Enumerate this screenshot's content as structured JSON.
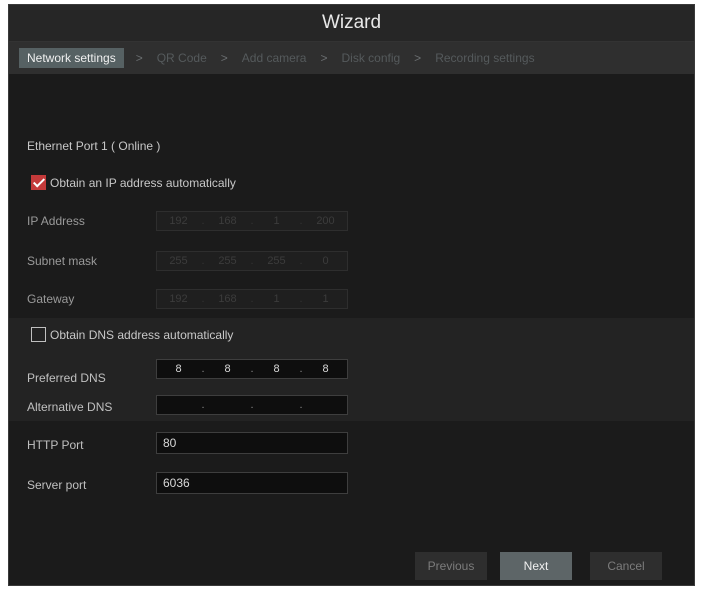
{
  "window": {
    "title": "Wizard"
  },
  "steps": [
    {
      "label": "Network settings",
      "active": true
    },
    {
      "label": "QR Code",
      "active": false
    },
    {
      "label": "Add camera",
      "active": false
    },
    {
      "label": "Disk config",
      "active": false
    },
    {
      "label": "Recording settings",
      "active": false
    }
  ],
  "separator": ">",
  "ethernet": {
    "title": "Ethernet Port 1 ( Online )"
  },
  "auto_ip": {
    "label": "Obtain an IP address automatically",
    "checked": true
  },
  "ip_address": {
    "label": "IP Address",
    "octets": [
      "192",
      "168",
      "1",
      "200"
    ],
    "enabled": false
  },
  "subnet_mask": {
    "label": "Subnet mask",
    "octets": [
      "255",
      "255",
      "255",
      "0"
    ],
    "enabled": false
  },
  "gateway": {
    "label": "Gateway",
    "octets": [
      "192",
      "168",
      "1",
      "1"
    ],
    "enabled": false
  },
  "auto_dns": {
    "label": "Obtain DNS address automatically",
    "checked": false
  },
  "preferred_dns": {
    "label": "Preferred DNS",
    "octets": [
      "8",
      "8",
      "8",
      "8"
    ],
    "enabled": true
  },
  "alternative_dns": {
    "label": "Alternative DNS",
    "octets": [
      "",
      "",
      "",
      ""
    ],
    "enabled": true
  },
  "http_port": {
    "label": "HTTP Port",
    "value": "80"
  },
  "server_port": {
    "label": "Server port",
    "value": "6036"
  },
  "buttons": {
    "previous": "Previous",
    "next": "Next",
    "cancel": "Cancel"
  }
}
